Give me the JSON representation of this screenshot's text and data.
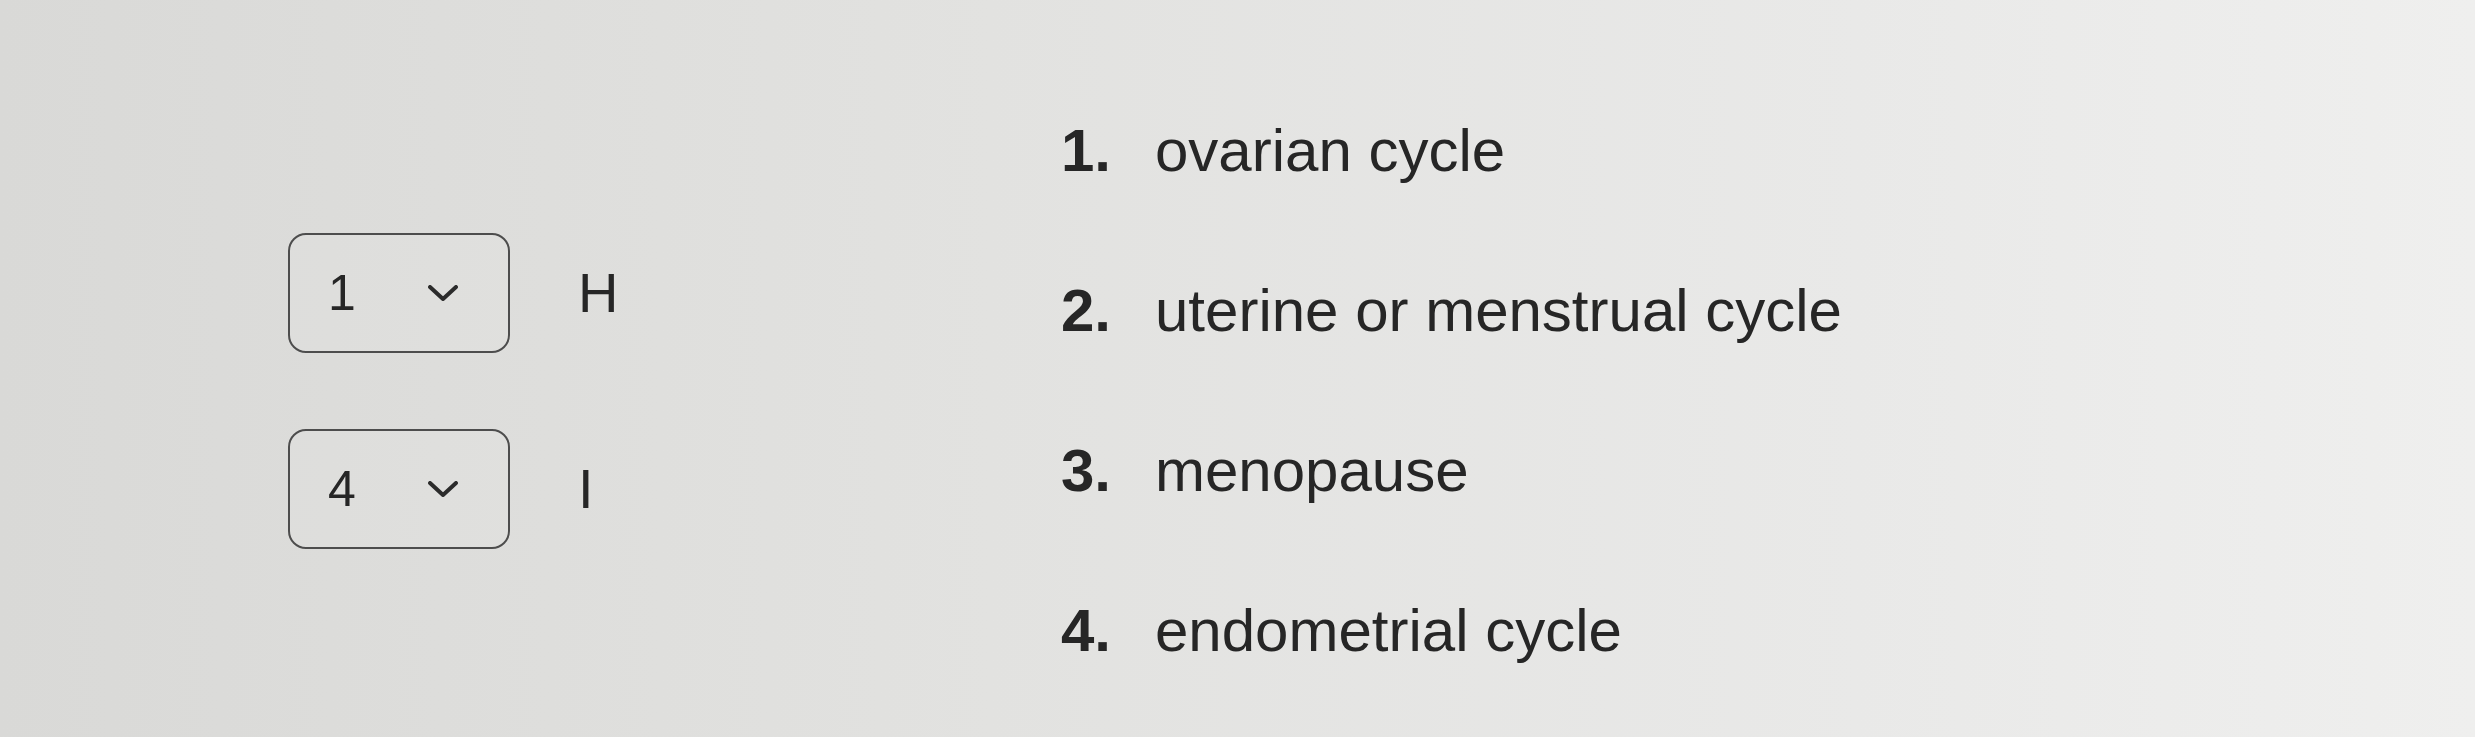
{
  "matches": [
    {
      "value": "1",
      "label": "H"
    },
    {
      "value": "4",
      "label": "I"
    }
  ],
  "options": [
    {
      "number": "1.",
      "text": "ovarian cycle"
    },
    {
      "number": "2.",
      "text": "uterine or menstrual cycle"
    },
    {
      "number": "3.",
      "text": "menopause"
    },
    {
      "number": "4.",
      "text": "endometrial cycle"
    }
  ]
}
